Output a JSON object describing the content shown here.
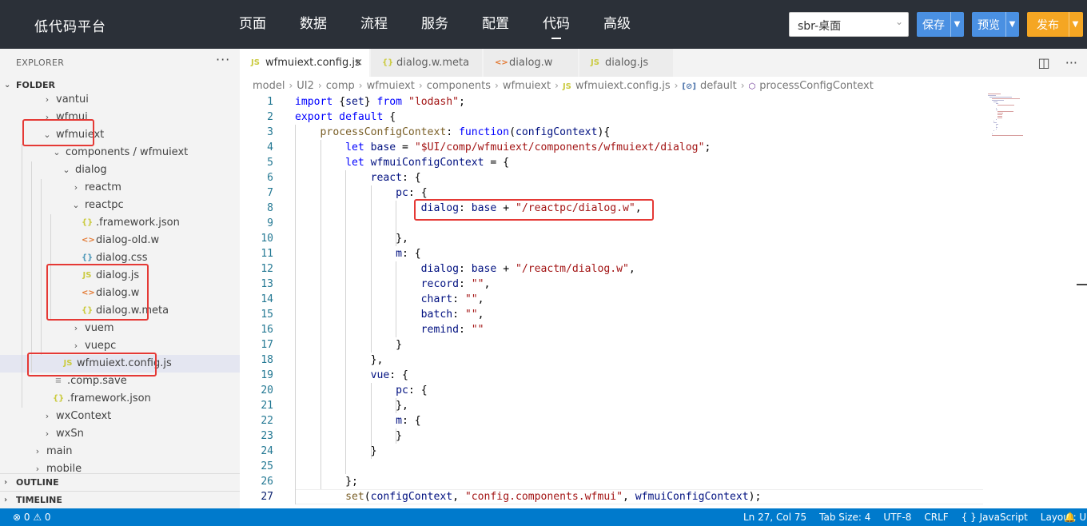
{
  "app": {
    "title": "低代码平台"
  },
  "nav": [
    "页面",
    "数据",
    "流程",
    "服务",
    "配置",
    "代码",
    "高级"
  ],
  "nav_active_index": 5,
  "env_select": {
    "value": "sbr-桌面"
  },
  "buttons": {
    "save": "保存",
    "preview": "预览",
    "publish": "发布"
  },
  "colors": {
    "topbar": "#2b3038",
    "button_blue": "#4a90e2",
    "button_orange": "#f5a623",
    "statusbar": "#007acc",
    "highlight": "#e53935"
  },
  "sidebar": {
    "explorer_label": "EXPLORER",
    "more_label": "···",
    "folder_label": "FOLDER",
    "outline_label": "OUTLINE",
    "timeline_label": "TIMELINE",
    "tree": [
      {
        "name": "vantui",
        "level": 2,
        "kind": "folder",
        "open": false
      },
      {
        "name": "wfmui",
        "level": 2,
        "kind": "folder",
        "open": false
      },
      {
        "name": "wfmuiext",
        "level": 2,
        "kind": "folder",
        "open": true
      },
      {
        "name": "components / wfmuiext",
        "level": 3,
        "kind": "folder",
        "open": true
      },
      {
        "name": "dialog",
        "level": 4,
        "kind": "folder",
        "open": true
      },
      {
        "name": "reactm",
        "level": 5,
        "kind": "folder",
        "open": false
      },
      {
        "name": "reactpc",
        "level": 5,
        "kind": "folder",
        "open": true
      },
      {
        "name": ".framework.json",
        "level": 6,
        "kind": "json",
        "icon": "{}"
      },
      {
        "name": "dialog-old.w",
        "level": 6,
        "kind": "w",
        "icon": "<>"
      },
      {
        "name": "dialog.css",
        "level": 6,
        "kind": "css",
        "icon": "{}"
      },
      {
        "name": "dialog.js",
        "level": 6,
        "kind": "js",
        "icon": "JS"
      },
      {
        "name": "dialog.w",
        "level": 6,
        "kind": "w",
        "icon": "<>"
      },
      {
        "name": "dialog.w.meta",
        "level": 6,
        "kind": "json",
        "icon": "{}"
      },
      {
        "name": "vuem",
        "level": 5,
        "kind": "folder",
        "open": false
      },
      {
        "name": "vuepc",
        "level": 5,
        "kind": "folder",
        "open": false
      },
      {
        "name": "wfmuiext.config.js",
        "level": 4,
        "kind": "js",
        "icon": "JS",
        "selected": true
      },
      {
        "name": ".comp.save",
        "level": 3,
        "kind": "save",
        "icon": "≡"
      },
      {
        "name": ".framework.json",
        "level": 3,
        "kind": "json",
        "icon": "{}"
      },
      {
        "name": "wxContext",
        "level": 2,
        "kind": "folder",
        "open": false
      },
      {
        "name": "wxSn",
        "level": 2,
        "kind": "folder",
        "open": false
      },
      {
        "name": "main",
        "level": 1,
        "kind": "folder",
        "open": false
      },
      {
        "name": "mobile",
        "level": 1,
        "kind": "folder",
        "open": false
      }
    ]
  },
  "tabs": [
    {
      "name": "wfmuiext.config.js",
      "kind": "js",
      "icon": "JS",
      "active": true,
      "close": "×"
    },
    {
      "name": "dialog.w.meta",
      "kind": "json",
      "icon": "{}"
    },
    {
      "name": "dialog.w",
      "kind": "w",
      "icon": "<>"
    },
    {
      "name": "dialog.js",
      "kind": "js",
      "icon": "JS"
    }
  ],
  "breadcrumb": [
    "model",
    "UI2",
    "comp",
    "wfmuiext",
    "components",
    "wfmuiext",
    "wfmuiext.config.js",
    "default",
    "processConfigContext"
  ],
  "code_lines": [
    [
      [
        "k",
        "import "
      ],
      [
        "p",
        "{"
      ],
      [
        "v",
        "set"
      ],
      [
        "p",
        "} "
      ],
      [
        "k",
        "from "
      ],
      [
        "s",
        "\"lodash\""
      ],
      [
        "p",
        ";"
      ]
    ],
    [
      [
        "k",
        "export default "
      ],
      [
        "p",
        "{"
      ]
    ],
    [
      [
        "p",
        "    "
      ],
      [
        "f",
        "processConfigContext"
      ],
      [
        "p",
        ": "
      ],
      [
        "k",
        "function"
      ],
      [
        "p",
        "("
      ],
      [
        "v",
        "configContext"
      ],
      [
        "p",
        "){"
      ]
    ],
    [
      [
        "p",
        "        "
      ],
      [
        "k",
        "let "
      ],
      [
        "v",
        "base"
      ],
      [
        "p",
        " = "
      ],
      [
        "s",
        "\"$UI/comp/wfmuiext/components/wfmuiext/dialog\""
      ],
      [
        "p",
        ";"
      ]
    ],
    [
      [
        "p",
        "        "
      ],
      [
        "k",
        "let "
      ],
      [
        "v",
        "wfmuiConfigContext"
      ],
      [
        "p",
        " = {"
      ]
    ],
    [
      [
        "p",
        "            "
      ],
      [
        "v",
        "react"
      ],
      [
        "p",
        ": {"
      ]
    ],
    [
      [
        "p",
        "                "
      ],
      [
        "v",
        "pc"
      ],
      [
        "p",
        ": {"
      ]
    ],
    [
      [
        "p",
        "                    "
      ],
      [
        "v",
        "dialog"
      ],
      [
        "p",
        ": "
      ],
      [
        "v",
        "base"
      ],
      [
        "p",
        " + "
      ],
      [
        "s",
        "\"/reactpc/dialog.w\""
      ],
      [
        "p",
        ","
      ]
    ],
    [
      [
        "p",
        ""
      ]
    ],
    [
      [
        "p",
        "                },"
      ]
    ],
    [
      [
        "p",
        "                "
      ],
      [
        "v",
        "m"
      ],
      [
        "p",
        ": {"
      ]
    ],
    [
      [
        "p",
        "                    "
      ],
      [
        "v",
        "dialog"
      ],
      [
        "p",
        ": "
      ],
      [
        "v",
        "base"
      ],
      [
        "p",
        " + "
      ],
      [
        "s",
        "\"/reactm/dialog.w\""
      ],
      [
        "p",
        ","
      ]
    ],
    [
      [
        "p",
        "                    "
      ],
      [
        "v",
        "record"
      ],
      [
        "p",
        ": "
      ],
      [
        "s",
        "\"\""
      ],
      [
        "p",
        ","
      ]
    ],
    [
      [
        "p",
        "                    "
      ],
      [
        "v",
        "chart"
      ],
      [
        "p",
        ": "
      ],
      [
        "s",
        "\"\""
      ],
      [
        "p",
        ","
      ]
    ],
    [
      [
        "p",
        "                    "
      ],
      [
        "v",
        "batch"
      ],
      [
        "p",
        ": "
      ],
      [
        "s",
        "\"\""
      ],
      [
        "p",
        ","
      ]
    ],
    [
      [
        "p",
        "                    "
      ],
      [
        "v",
        "remind"
      ],
      [
        "p",
        ": "
      ],
      [
        "s",
        "\"\""
      ]
    ],
    [
      [
        "p",
        "                }"
      ]
    ],
    [
      [
        "p",
        "            },"
      ]
    ],
    [
      [
        "p",
        "            "
      ],
      [
        "v",
        "vue"
      ],
      [
        "p",
        ": {"
      ]
    ],
    [
      [
        "p",
        "                "
      ],
      [
        "v",
        "pc"
      ],
      [
        "p",
        ": {"
      ]
    ],
    [
      [
        "p",
        "                },"
      ]
    ],
    [
      [
        "p",
        "                "
      ],
      [
        "v",
        "m"
      ],
      [
        "p",
        ": {"
      ]
    ],
    [
      [
        "p",
        "                }"
      ]
    ],
    [
      [
        "p",
        "            }"
      ]
    ],
    [
      [
        "p",
        ""
      ]
    ],
    [
      [
        "p",
        "        };"
      ]
    ],
    [
      [
        "p",
        "        "
      ],
      [
        "f",
        "set"
      ],
      [
        "p",
        "("
      ],
      [
        "v",
        "configContext"
      ],
      [
        "p",
        ", "
      ],
      [
        "s",
        "\"config.components.wfmui\""
      ],
      [
        "p",
        ", "
      ],
      [
        "v",
        "wfmuiConfigContext"
      ],
      [
        "p",
        ");"
      ]
    ]
  ],
  "status": {
    "errors": "⊗ 0  ⚠ 0",
    "position": "Ln 27, Col 75",
    "tab_size": "Tab Size: 4",
    "encoding": "UTF-8",
    "eol": "CRLF",
    "language": "{ } JavaScript",
    "layout": "Layout: US",
    "bell": "🔔"
  }
}
